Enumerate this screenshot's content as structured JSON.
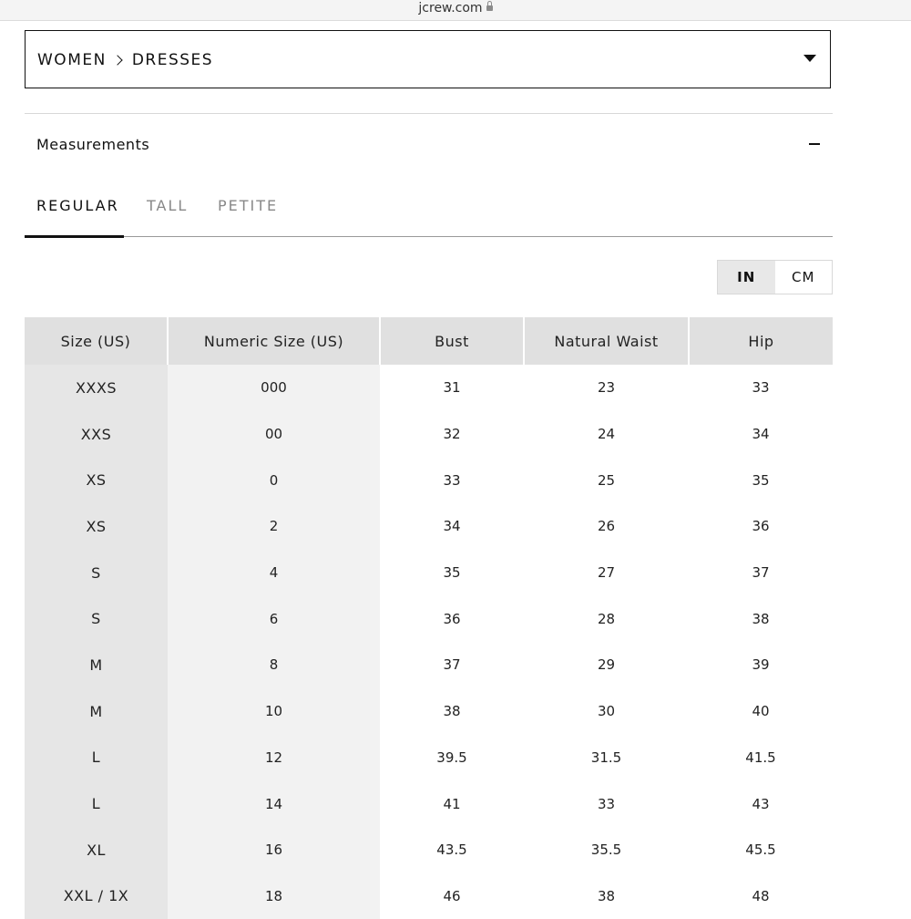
{
  "browser": {
    "url": "jcrew.com"
  },
  "category": {
    "root": "WOMEN",
    "current": "DRESSES"
  },
  "measurements": {
    "title": "Measurements"
  },
  "tabs": [
    {
      "label": "REGULAR",
      "active": true
    },
    {
      "label": "TALL",
      "active": false
    },
    {
      "label": "PETITE",
      "active": false
    }
  ],
  "units": {
    "options": [
      "IN",
      "CM"
    ],
    "selected": "IN"
  },
  "table": {
    "headers": [
      "Size (US)",
      "Numeric Size (US)",
      "Bust",
      "Natural Waist",
      "Hip"
    ],
    "rows": [
      [
        "XXXS",
        "000",
        "31",
        "23",
        "33"
      ],
      [
        "XXS",
        "00",
        "32",
        "24",
        "34"
      ],
      [
        "XS",
        "0",
        "33",
        "25",
        "35"
      ],
      [
        "XS",
        "2",
        "34",
        "26",
        "36"
      ],
      [
        "S",
        "4",
        "35",
        "27",
        "37"
      ],
      [
        "S",
        "6",
        "36",
        "28",
        "38"
      ],
      [
        "M",
        "8",
        "37",
        "29",
        "39"
      ],
      [
        "M",
        "10",
        "38",
        "30",
        "40"
      ],
      [
        "L",
        "12",
        "39.5",
        "31.5",
        "41.5"
      ],
      [
        "L",
        "14",
        "41",
        "33",
        "43"
      ],
      [
        "XL",
        "16",
        "43.5",
        "35.5",
        "45.5"
      ],
      [
        "XXL / 1X",
        "18",
        "46",
        "38",
        "48"
      ]
    ]
  },
  "colors": {
    "header_bg": "#e0e0e0",
    "size_col_bg": "#e6e6e6",
    "numeric_col_bg": "#f2f2f2",
    "active_unit_bg": "#e8e8e8"
  }
}
